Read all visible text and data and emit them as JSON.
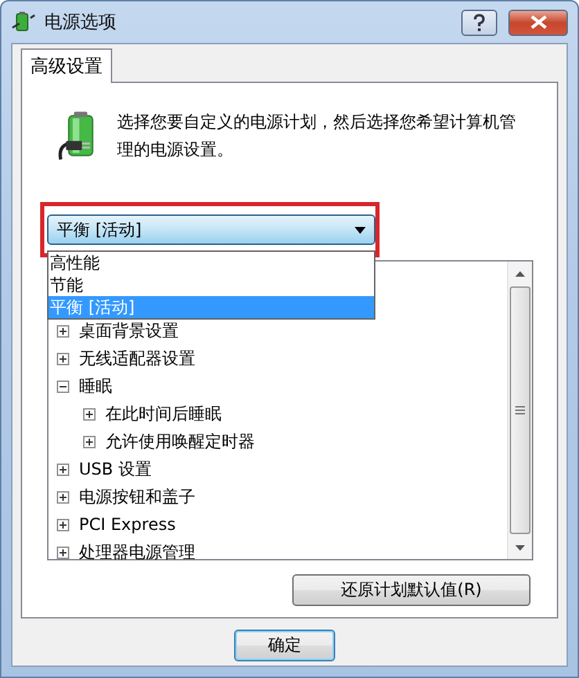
{
  "window": {
    "title": "电源选项"
  },
  "tabs": [
    {
      "label": "高级设置",
      "selected": true
    }
  ],
  "description": "选择您要自定义的电源计划，然后选择您希望计算机管理的电源设置。",
  "plan_select": {
    "value": "平衡 [活动]",
    "highlighted": true,
    "expanded": true
  },
  "plan_options": [
    {
      "label": "高性能",
      "selected": false
    },
    {
      "label": "节能",
      "selected": false
    },
    {
      "label": "平衡 [活动]",
      "selected": true
    }
  ],
  "settings_tree": [
    {
      "label": "桌面背景设置",
      "expanded": false
    },
    {
      "label": "无线适配器设置",
      "expanded": false
    },
    {
      "label": "睡眠",
      "expanded": true,
      "children": [
        {
          "label": "在此时间后睡眠",
          "expanded": false
        },
        {
          "label": "允许使用唤醒定时器",
          "expanded": false
        }
      ]
    },
    {
      "label": "USB 设置",
      "expanded": false
    },
    {
      "label": "电源按钮和盖子",
      "expanded": false
    },
    {
      "label": "PCI Express",
      "expanded": false
    },
    {
      "label": "处理器电源管理",
      "expanded": false
    }
  ],
  "restore_button": "还原计划默认值(R)",
  "dialog_buttons": [
    "确定"
  ]
}
